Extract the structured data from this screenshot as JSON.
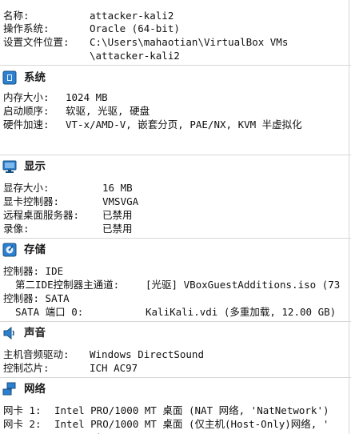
{
  "general": {
    "name_label": "名称:",
    "name_value": "attacker-kali2",
    "os_label": "操作系统:",
    "os_value": "Oracle (64-bit)",
    "config_label": "设置文件位置:",
    "config_value_line1": "C:\\Users\\mahaotian\\VirtualBox VMs",
    "config_value_line2": "\\attacker-kali2"
  },
  "system": {
    "title": "系统",
    "icon": "chip-icon",
    "memory_label": "内存大小:",
    "memory_value": "1024 MB",
    "boot_label": "启动顺序:",
    "boot_value": "软驱, 光驱, 硬盘",
    "accel_label": "硬件加速:",
    "accel_value": "VT-x/AMD-V, 嵌套分页, PAE/NX, KVM 半虚拟化"
  },
  "display": {
    "title": "显示",
    "icon": "monitor-icon",
    "vram_label": "显存大小:",
    "vram_value": "16 MB",
    "controller_label": "显卡控制器:",
    "controller_value": "VMSVGA",
    "rdp_label": "远程桌面服务器:",
    "rdp_value": "已禁用",
    "recording_label": "录像:",
    "recording_value": "已禁用"
  },
  "storage": {
    "title": "存储",
    "icon": "storage-icon",
    "ide_label": "控制器: IDE",
    "ide_port_label": "  第二IDE控制器主通道:",
    "ide_port_value": "[光驱] VBoxGuestAdditions.iso (73",
    "sata_label": "控制器: SATA",
    "sata_port_label": "  SATA 端口 0:",
    "sata_port_value": "KaliKali.vdi (多重加载, 12.00 GB)"
  },
  "audio": {
    "title": "声音",
    "icon": "speaker-icon",
    "driver_label": "主机音频驱动:",
    "driver_value": "Windows DirectSound",
    "chip_label": "控制芯片:",
    "chip_value": "ICH AC97"
  },
  "network": {
    "title": "网络",
    "icon": "network-icon",
    "nic1_label": "网卡 1:",
    "nic1_value": "Intel PRO/1000 MT 桌面 (NAT 网络, 'NatNetwork')",
    "nic2_label": "网卡 2:",
    "nic2_value": "Intel PRO/1000 MT 桌面 (仅主机(Host-Only)网络, '",
    "nic2_cont": "   ...')"
  },
  "colors": {
    "accent_blue": "#1e73be",
    "section_divider": "#d7d7d7"
  }
}
